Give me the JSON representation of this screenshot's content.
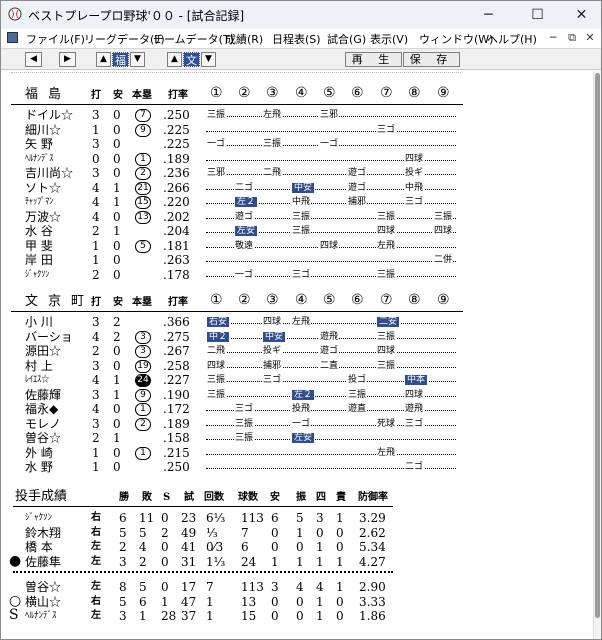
{
  "window": {
    "title": "ベストプレープロ野球'００ - [試合記録]",
    "icon": "baseball-app-icon"
  },
  "menu": [
    "ファイル(F)",
    "リーグデータ(L)",
    "チームデータ(T)",
    "成績(R)",
    "日程表(S)",
    "試合(G)",
    "表示(V)",
    "ウィンドウ(W)",
    "ヘルプ(H)"
  ],
  "toolbar": {
    "left": "◀",
    "right": "▶",
    "up1": "▲",
    "team1": "福",
    "down1": "▼",
    "up2": "▲",
    "team2": "文",
    "down2": "▼",
    "play": "再 生",
    "save": "保 存"
  },
  "headers": {
    "hits": "打",
    "an": "安",
    "hr": "本塁",
    "avg": "打率",
    "innings": [
      "①",
      "②",
      "③",
      "④",
      "⑤",
      "⑥",
      "⑦",
      "⑧",
      "⑨"
    ]
  },
  "team1": {
    "name": "福島",
    "players": [
      {
        "name": "ドイル☆",
        "ab": "3",
        "h": "0",
        "hr": "⑦",
        "avg": ".250",
        "res": [
          "三振",
          "",
          "左飛",
          "",
          "三邪",
          "",
          "",
          "",
          ""
        ]
      },
      {
        "name": "細川☆",
        "ab": "1",
        "h": "0",
        "hr": "⑨",
        "avg": ".225",
        "res": [
          "",
          "",
          "",
          "",
          "",
          "",
          "三ゴ",
          "",
          ""
        ]
      },
      {
        "name": "矢 野",
        "ab": "3",
        "h": "0",
        "hr": "",
        "avg": ".225",
        "res": [
          "一ゴ",
          "",
          "三振",
          "",
          "一ゴ",
          "",
          "",
          "",
          ""
        ]
      },
      {
        "name": "ﾍﾙﾅﾝﾃﾞｽ",
        "ab": "0",
        "h": "0",
        "hr": "①",
        "avg": ".189",
        "res": [
          "",
          "",
          "",
          "",
          "",
          "",
          "",
          "四球",
          ""
        ]
      },
      {
        "name": "吉川尚☆",
        "ab": "3",
        "h": "0",
        "hr": "②",
        "avg": ".236",
        "res": [
          "三邪",
          "",
          "二飛",
          "",
          "",
          "遊ゴ",
          "",
          "投ギ",
          ""
        ]
      },
      {
        "name": "ソト☆",
        "ab": "4",
        "h": "1",
        "hr": "㉑",
        "avg": ".266",
        "res": [
          "",
          "二ゴ",
          "",
          "中安",
          "",
          "遊ゴ",
          "",
          "中飛",
          ""
        ]
      },
      {
        "name": "ﾁｬｯﾌﾟﾏﾝ",
        "ab": "4",
        "h": "1",
        "hr": "⑮",
        "avg": ".220",
        "res": [
          "",
          "左２",
          "",
          "中飛",
          "",
          "捕邪",
          "",
          "三ゴ",
          ""
        ]
      },
      {
        "name": "万波☆",
        "ab": "4",
        "h": "0",
        "hr": "⑬",
        "avg": ".202",
        "res": [
          "",
          "遊ゴ",
          "",
          "三振",
          "",
          "",
          "三振",
          "",
          "三振"
        ]
      },
      {
        "name": "水 谷",
        "ab": "2",
        "h": "1",
        "hr": "",
        "avg": ".204",
        "res": [
          "",
          "左安",
          "",
          "三振",
          "",
          "",
          "四球",
          "",
          "四球"
        ]
      },
      {
        "name": "甲 斐",
        "ab": "1",
        "h": "0",
        "hr": "⑤",
        "avg": ".181",
        "res": [
          "",
          "敬遠",
          "",
          "",
          "四球",
          "",
          "左飛",
          "",
          ""
        ]
      },
      {
        "name": "岸 田",
        "ab": "1",
        "h": "0",
        "hr": "",
        "avg": ".263",
        "res": [
          "",
          "",
          "",
          "",
          "",
          "",
          "",
          "",
          "二併"
        ]
      },
      {
        "name": "ｼﾞｬｸｿﾝ",
        "ab": "2",
        "h": "0",
        "hr": "",
        "avg": ".178",
        "res": [
          "",
          "一ゴ",
          "",
          "三ゴ",
          "",
          "",
          "三振",
          "",
          ""
        ]
      }
    ]
  },
  "team2": {
    "name": "文京町",
    "players": [
      {
        "name": "小 川",
        "ab": "3",
        "h": "2",
        "hr": "",
        "avg": ".366",
        "res": [
          "右安",
          "",
          "四球",
          "左飛",
          "",
          "",
          "二安",
          "",
          ""
        ]
      },
      {
        "name": "バーショ",
        "ab": "4",
        "h": "2",
        "hr": "③",
        "avg": ".275",
        "res": [
          "中２",
          "",
          "中安",
          "",
          "遊飛",
          "",
          "三振",
          "",
          ""
        ]
      },
      {
        "name": "源田☆",
        "ab": "2",
        "h": "0",
        "hr": "③",
        "avg": ".267",
        "res": [
          "二飛",
          "",
          "投ギ",
          "",
          "遊ゴ",
          "",
          "四球",
          "",
          ""
        ]
      },
      {
        "name": "村 上",
        "ab": "3",
        "h": "0",
        "hr": "⑲",
        "avg": ".258",
        "res": [
          "四球",
          "",
          "捕邪",
          "",
          "二直",
          "",
          "三振",
          "",
          ""
        ]
      },
      {
        "name": "ﾚｲｴｽ☆",
        "ab": "4",
        "h": "1",
        "hr": "㉔",
        "avg": ".227",
        "res": [
          "三振",
          "",
          "三ゴ",
          "",
          "",
          "投ゴ",
          "",
          "中本",
          ""
        ]
      },
      {
        "name": "佐藤輝",
        "ab": "3",
        "h": "1",
        "hr": "⑨",
        "avg": ".190",
        "res": [
          "三振",
          "",
          "",
          "左２",
          "",
          "三振",
          "",
          "四球",
          ""
        ]
      },
      {
        "name": "福永◆",
        "ab": "4",
        "h": "0",
        "hr": "①",
        "avg": ".172",
        "res": [
          "",
          "三ゴ",
          "",
          "投飛",
          "",
          "遊直",
          "",
          "遊飛",
          ""
        ]
      },
      {
        "name": "モレノ",
        "ab": "3",
        "h": "0",
        "hr": "②",
        "avg": ".189",
        "res": [
          "",
          "三振",
          "",
          "一ゴ",
          "",
          "",
          "死球",
          "三ゴ",
          ""
        ]
      },
      {
        "name": "曽谷☆",
        "ab": "2",
        "h": "1",
        "hr": "",
        "avg": ".158",
        "res": [
          "",
          "三振",
          "",
          "左安",
          "",
          "",
          "",
          "",
          ""
        ]
      },
      {
        "name": "外 崎",
        "ab": "1",
        "h": "0",
        "hr": "①",
        "avg": ".215",
        "res": [
          "",
          "",
          "",
          "",
          "",
          "",
          "左飛",
          "",
          ""
        ]
      },
      {
        "name": "水 野",
        "ab": "1",
        "h": "0",
        "hr": "",
        "avg": ".250",
        "res": [
          "",
          "",
          "",
          "",
          "",
          "",
          "",
          "二ゴ",
          ""
        ]
      }
    ]
  },
  "pitching": {
    "title": "投手成績",
    "headers": [
      "勝",
      "敗",
      "S",
      "試",
      "回数",
      "球数",
      "安",
      "振",
      "四",
      "責",
      "防御率"
    ],
    "team1": [
      {
        "mark": "",
        "name": "ｼﾞｬｸｿﾝ",
        "hand": "右",
        "w": "6",
        "l": "11",
        "s": "0",
        "g": "23",
        "ip": "6⅓",
        "np": "113",
        "h": "6",
        "k": "5",
        "bb": "3",
        "er": "1",
        "era": "3.29"
      },
      {
        "mark": "",
        "name": "鈴木翔",
        "hand": "右",
        "w": "5",
        "l": "5",
        "s": "2",
        "g": "49",
        "ip": "⅓",
        "np": "7",
        "h": "0",
        "k": "1",
        "bb": "0",
        "er": "0",
        "era": "2.62"
      },
      {
        "mark": "",
        "name": "橋 本",
        "hand": "左",
        "w": "2",
        "l": "4",
        "s": "0",
        "g": "41",
        "ip": "0⁄3",
        "np": "6",
        "h": "0",
        "k": "0",
        "bb": "1",
        "er": "0",
        "era": "5.34"
      },
      {
        "mark": "●",
        "name": "佐藤隼",
        "hand": "左",
        "w": "3",
        "l": "2",
        "s": "0",
        "g": "31",
        "ip": "1⅓",
        "np": "24",
        "h": "1",
        "k": "1",
        "bb": "1",
        "er": "1",
        "era": "4.27"
      }
    ],
    "team2": [
      {
        "mark": "",
        "name": "曽谷☆",
        "hand": "左",
        "w": "8",
        "l": "5",
        "s": "0",
        "g": "17",
        "ip": "7",
        "np": "113",
        "h": "3",
        "k": "4",
        "bb": "4",
        "er": "1",
        "era": "2.90"
      },
      {
        "mark": "○",
        "name": "横山☆",
        "hand": "右",
        "w": "5",
        "l": "6",
        "s": "1",
        "g": "47",
        "ip": "1",
        "np": "13",
        "h": "0",
        "k": "0",
        "bb": "1",
        "er": "0",
        "era": "3.33"
      },
      {
        "mark": "S",
        "name": "ﾍﾙﾅﾝﾃﾞｽ",
        "hand": "左",
        "w": "3",
        "l": "1",
        "s": "28",
        "g": "37",
        "ip": "1",
        "np": "15",
        "h": "0",
        "k": "0",
        "bb": "1",
        "er": "0",
        "era": "1.86"
      }
    ]
  }
}
